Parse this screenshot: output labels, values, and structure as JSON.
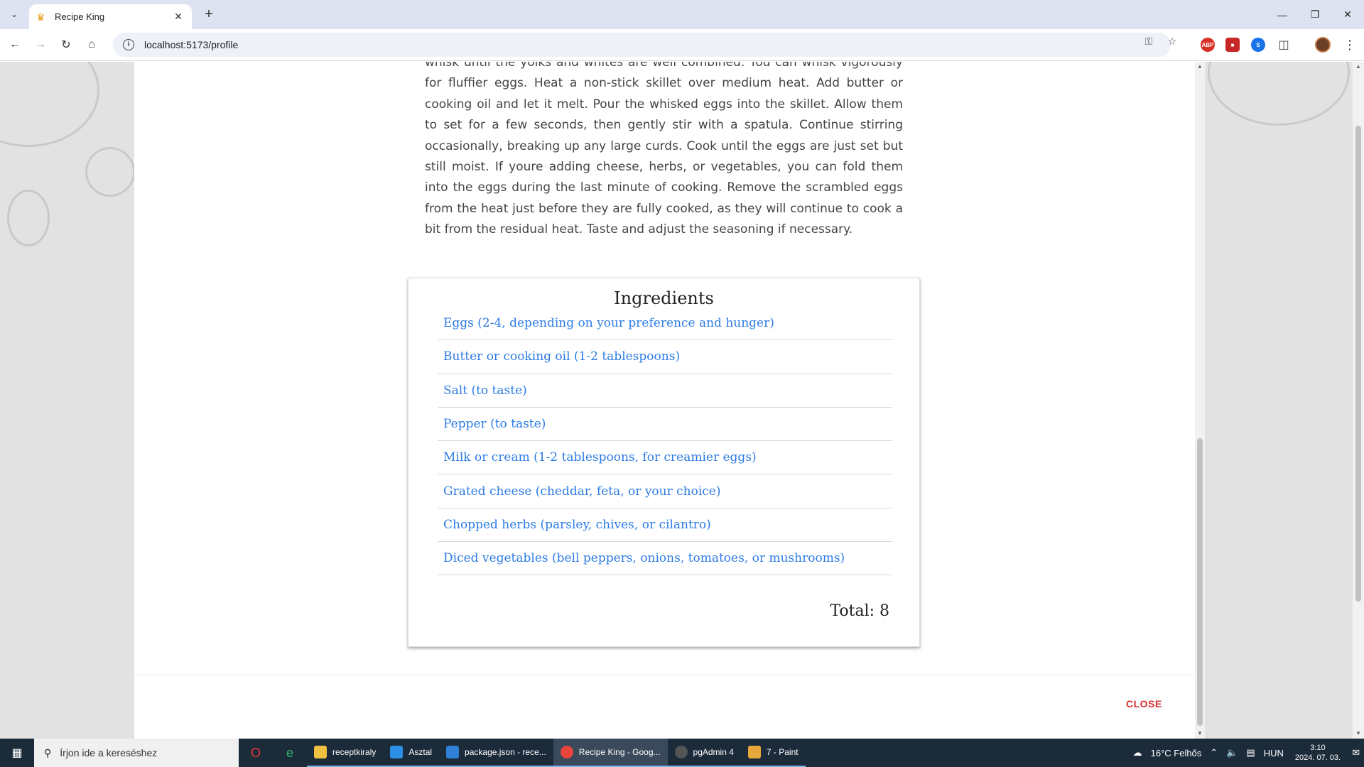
{
  "browser": {
    "tab_title": "Recipe King",
    "url": "localhost:5173/profile"
  },
  "recipe": {
    "instructions": "whisk until the yolks and whites are well combined. You can whisk vigorously for fluffier eggs. Heat a non-stick skillet over medium heat. Add butter or cooking oil and let it melt. Pour the whisked eggs into the skillet. Allow them to set for a few seconds, then gently stir with a spatula. Continue stirring occasionally, breaking up any large curds. Cook until the eggs are just set but still moist. If youre adding cheese, herbs, or vegetables, you can fold them into the eggs during the last minute of cooking. Remove the scrambled eggs from the heat just before they are fully cooked, as they will continue to cook a bit from the residual heat. Taste and adjust the seasoning if necessary.",
    "ingredients_title": "Ingredients",
    "ingredients": [
      "Eggs (2-4, depending on your preference and hunger)",
      "Butter or cooking oil (1-2 tablespoons)",
      "Salt (to taste)",
      "Pepper (to taste)",
      "Milk or cream (1-2 tablespoons, for creamier eggs)",
      "Grated cheese (cheddar, feta, or your choice)",
      "Chopped herbs (parsley, chives, or cilantro)",
      "Diced vegetables (bell peppers, onions, tomatoes, or mushrooms)"
    ],
    "total_label": "Total: 8"
  },
  "modal": {
    "close_label": "CLOSE"
  },
  "taskbar": {
    "search_placeholder": "Írjon ide a kereséshez",
    "apps": [
      {
        "label": "receptkiraly",
        "color": "#f0c040"
      },
      {
        "label": "Asztal",
        "color": "#2d8ee6"
      },
      {
        "label": "package.json - rece...",
        "color": "#2f80d6"
      },
      {
        "label": "Recipe King - Goog...",
        "color": "#e9453a"
      },
      {
        "label": "pgAdmin 4",
        "color": "#555555"
      },
      {
        "label": "7 - Paint",
        "color": "#e7a83b"
      }
    ],
    "weather": "16°C  Felhős",
    "language": "HUN",
    "time": "3:10",
    "date": "2024. 07. 03."
  },
  "colors": {
    "link": "#2c7be5",
    "close": "#d32f2f"
  }
}
